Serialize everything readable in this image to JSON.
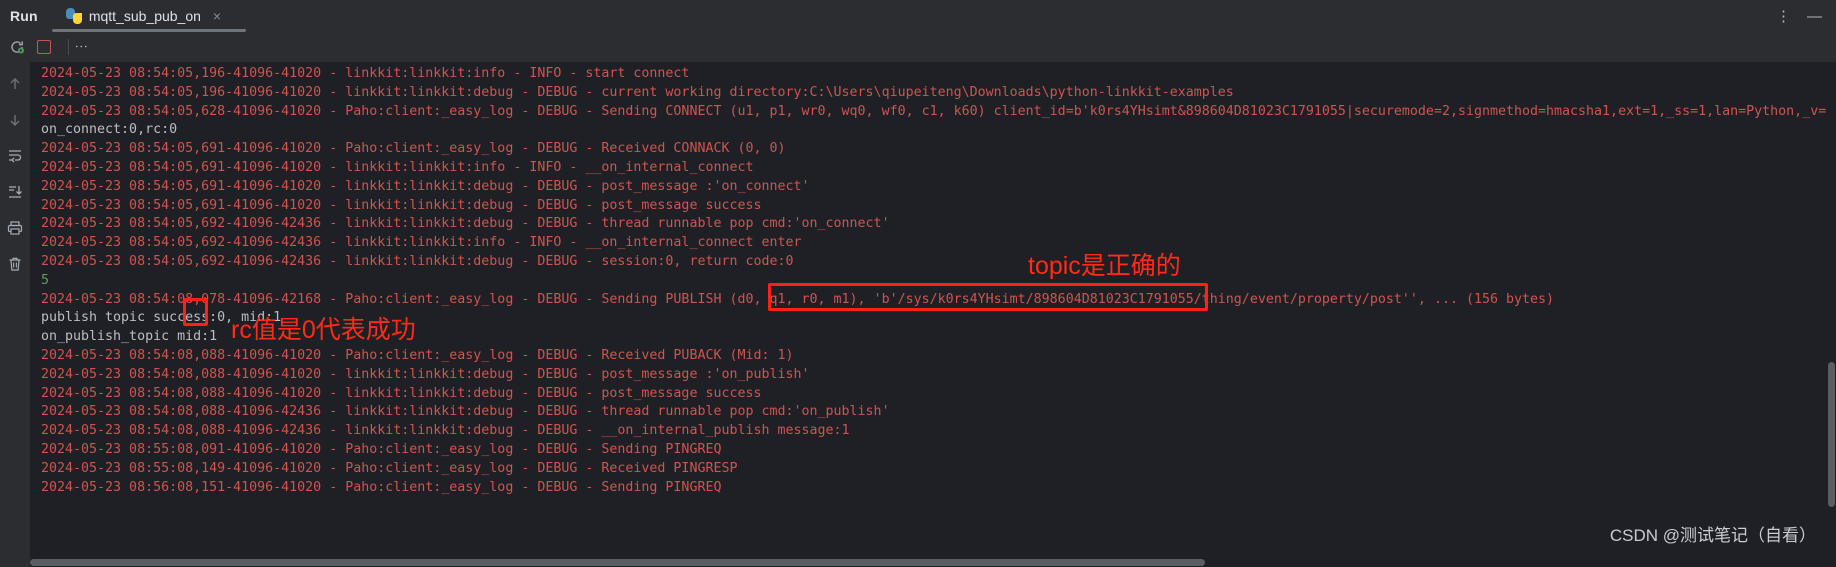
{
  "window": {
    "run_label": "Run",
    "tab": {
      "title": "mqtt_sub_pub_on",
      "close": "×",
      "icon": "python-icon"
    },
    "more_icon": "⋮",
    "minimize_icon": "—"
  },
  "toolbar": {
    "rerun_icon": "rerun-icon",
    "stop_icon": "stop-icon",
    "more_icon": "⋮"
  },
  "gutter": {
    "items": [
      {
        "icon": "arrow-up-icon",
        "name": "scroll-up-button"
      },
      {
        "icon": "arrow-down-icon",
        "name": "scroll-down-button"
      },
      {
        "icon": "soft-wrap-icon",
        "name": "soft-wrap-button"
      },
      {
        "icon": "scroll-to-end-icon",
        "name": "scroll-to-end-button"
      },
      {
        "icon": "print-icon",
        "name": "print-button"
      },
      {
        "icon": "trash-icon",
        "name": "clear-all-button"
      }
    ]
  },
  "console": {
    "lines": [
      {
        "type": "log",
        "text": "2024-05-23 08:54:05,196-41096-41020 - linkkit:linkkit:info - INFO - start connect"
      },
      {
        "type": "log",
        "text": "2024-05-23 08:54:05,196-41096-41020 - linkkit:linkkit:debug - DEBUG - current working directory:C:\\Users\\qiupeiteng\\Downloads\\python-linkkit-examples"
      },
      {
        "type": "log",
        "text": "2024-05-23 08:54:05,628-41096-41020 - Paho:client:_easy_log - DEBUG - Sending CONNECT (u1, p1, wr0, wq0, wf0, c1, k60) client_id=b'k0rs4YHsimt&898604D81023C1791055|securemode=2,signmethod=hmacsha1,ext=1,_ss=1,lan=Python,_v="
      },
      {
        "type": "out",
        "text": "on_connect:0,rc:0"
      },
      {
        "type": "log",
        "text": "2024-05-23 08:54:05,691-41096-41020 - Paho:client:_easy_log - DEBUG - Received CONNACK (0, 0)"
      },
      {
        "type": "log",
        "text": "2024-05-23 08:54:05,691-41096-41020 - linkkit:linkkit:info - INFO - __on_internal_connect"
      },
      {
        "type": "log",
        "text": "2024-05-23 08:54:05,691-41096-41020 - linkkit:linkkit:debug - DEBUG - post_message :'on_connect'"
      },
      {
        "type": "log",
        "text": "2024-05-23 08:54:05,691-41096-41020 - linkkit:linkkit:debug - DEBUG - post_message success"
      },
      {
        "type": "log",
        "text": "2024-05-23 08:54:05,692-41096-42436 - linkkit:linkkit:debug - DEBUG - thread runnable pop cmd:'on_connect'"
      },
      {
        "type": "log",
        "text": "2024-05-23 08:54:05,692-41096-42436 - linkkit:linkkit:info - INFO - __on_internal_connect enter"
      },
      {
        "type": "log",
        "text": "2024-05-23 08:54:05,692-41096-42436 - linkkit:linkkit:debug - DEBUG - session:0, return code:0"
      },
      {
        "type": "green",
        "text": "5"
      },
      {
        "type": "log",
        "text": "2024-05-23 08:54:08,078-41096-42168 - Paho:client:_easy_log - DEBUG - Sending PUBLISH (d0, q1, r0, m1), 'b'/sys/k0rs4YHsimt/898604D81023C1791055/thing/event/property/post'', ... (156 bytes)"
      },
      {
        "type": "out",
        "text": "publish topic success:0, mid:1"
      },
      {
        "type": "out",
        "text": "on_publish_topic mid:1"
      },
      {
        "type": "log",
        "text": "2024-05-23 08:54:08,088-41096-41020 - Paho:client:_easy_log - DEBUG - Received PUBACK (Mid: 1)"
      },
      {
        "type": "log",
        "text": "2024-05-23 08:54:08,088-41096-41020 - linkkit:linkkit:debug - DEBUG - post_message :'on_publish'"
      },
      {
        "type": "log",
        "text": "2024-05-23 08:54:08,088-41096-41020 - linkkit:linkkit:debug - DEBUG - post_message success"
      },
      {
        "type": "log",
        "text": "2024-05-23 08:54:08,088-41096-42436 - linkkit:linkkit:debug - DEBUG - thread runnable pop cmd:'on_publish'"
      },
      {
        "type": "log",
        "text": "2024-05-23 08:54:08,088-41096-42436 - linkkit:linkkit:debug - DEBUG - __on_internal_publish message:1"
      },
      {
        "type": "log",
        "text": "2024-05-23 08:55:08,091-41096-41020 - Paho:client:_easy_log - DEBUG - Sending PINGREQ"
      },
      {
        "type": "log",
        "text": "2024-05-23 08:55:08,149-41096-41020 - Paho:client:_easy_log - DEBUG - Received PINGRESP"
      },
      {
        "type": "log",
        "text": "2024-05-23 08:56:08,151-41096-41020 - Paho:client:_easy_log - DEBUG - Sending PINGREQ"
      }
    ]
  },
  "annotations": {
    "topic_note": "topic是正确的",
    "rc_note": "rc值是0代表成功",
    "topic_box_name": "topic-highlight-box",
    "rc_box_name": "rc-highlight-box"
  },
  "watermark": "CSDN @测试笔记（自看）",
  "colors": {
    "log_red": "#d0544f",
    "stdout": "#bcbec4",
    "green": "#5aa15a",
    "annotation_red": "#ff2116",
    "background": "#1e2025",
    "chrome": "#2b2d30"
  }
}
